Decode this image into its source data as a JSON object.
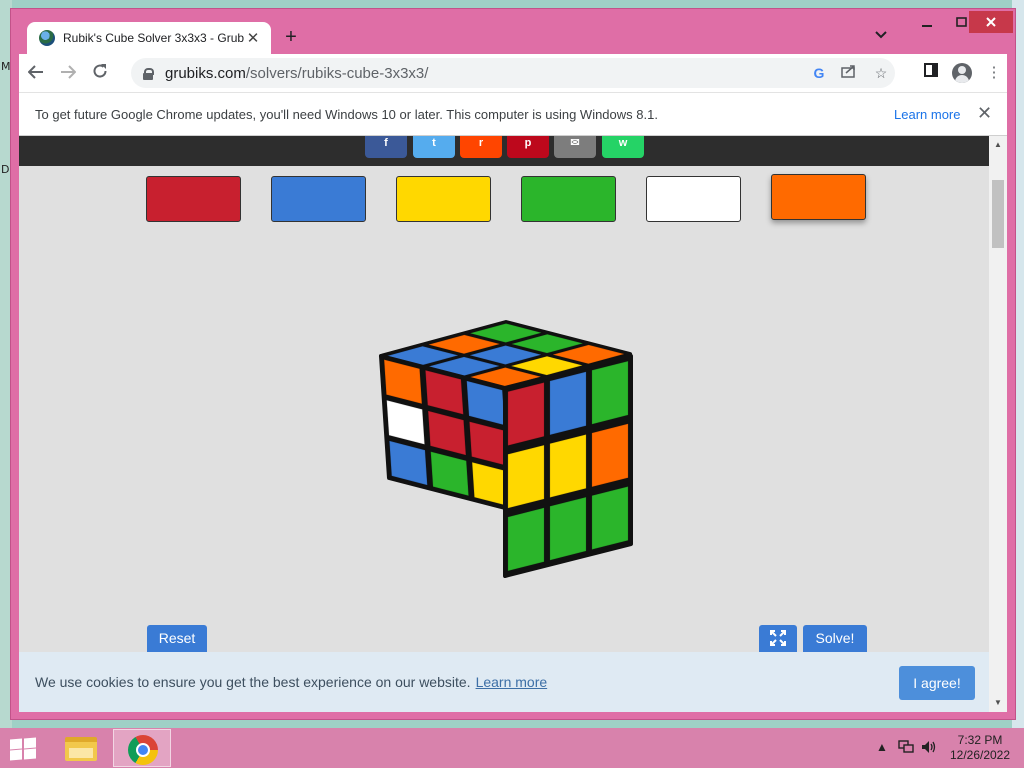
{
  "desktop": {
    "left_fragments": [
      "M",
      "D"
    ]
  },
  "window": {
    "minimize_icon": "minimize-icon",
    "maximize_icon": "maximize-icon",
    "close_icon": "close-icon"
  },
  "tab": {
    "title": "Rubik's Cube Solver 3x3x3 - Grub",
    "close": "✕",
    "new_tab": "+"
  },
  "toolbar": {
    "url_host": "grubiks.com",
    "url_path": "/solvers/rubiks-cube-3x3x3/",
    "icons": [
      "back-icon",
      "forward-icon",
      "reload-icon",
      "google-icon",
      "share-icon",
      "star-icon",
      "side-panel-icon",
      "profile-icon",
      "more-icon"
    ]
  },
  "infobar": {
    "message": "To get future Google Chrome updates, you'll need Windows 10 or later. This computer is using Windows 8.1.",
    "learn_more": "Learn more",
    "close": "✕"
  },
  "share": [
    {
      "name": "facebook",
      "glyph": "f",
      "color": "#3b5998"
    },
    {
      "name": "twitter",
      "glyph": "t",
      "color": "#55acee"
    },
    {
      "name": "reddit",
      "glyph": "r",
      "color": "#ff4500"
    },
    {
      "name": "pinterest",
      "glyph": "p",
      "color": "#bd081c"
    },
    {
      "name": "email",
      "glyph": "✉",
      "color": "#7d7d7d"
    },
    {
      "name": "whatsapp",
      "glyph": "w",
      "color": "#25d366"
    }
  ],
  "colors": {
    "palette": [
      {
        "name": "red",
        "hex": "#c8202f"
      },
      {
        "name": "blue",
        "hex": "#3a7bd5"
      },
      {
        "name": "yellow",
        "hex": "#ffd800"
      },
      {
        "name": "green",
        "hex": "#2bb52b"
      },
      {
        "name": "white",
        "hex": "#ffffff"
      },
      {
        "name": "orange",
        "hex": "#ff6a00"
      }
    ],
    "selected": "orange"
  },
  "cube": {
    "top": [
      [
        "blue",
        "orange",
        "green"
      ],
      [
        "blue",
        "blue",
        "green"
      ],
      [
        "orange",
        "yellow",
        "orange"
      ]
    ],
    "left": [
      [
        "orange",
        "red",
        "blue"
      ],
      [
        "white",
        "red",
        "red"
      ],
      [
        "blue",
        "green",
        "yellow"
      ]
    ],
    "right": [
      [
        "red",
        "blue",
        "green"
      ],
      [
        "yellow",
        "yellow",
        "orange"
      ],
      [
        "green",
        "green",
        "green"
      ]
    ]
  },
  "controls": {
    "reset": "Reset",
    "solve": "Solve!",
    "fullscreen_icon": "fullscreen-icon"
  },
  "cookie": {
    "text": "We use cookies to ensure you get the best experience on our website.",
    "link": "Learn more",
    "button": "I agree!"
  },
  "taskbar": {
    "time": "7:32 PM",
    "date": "12/26/2022"
  }
}
